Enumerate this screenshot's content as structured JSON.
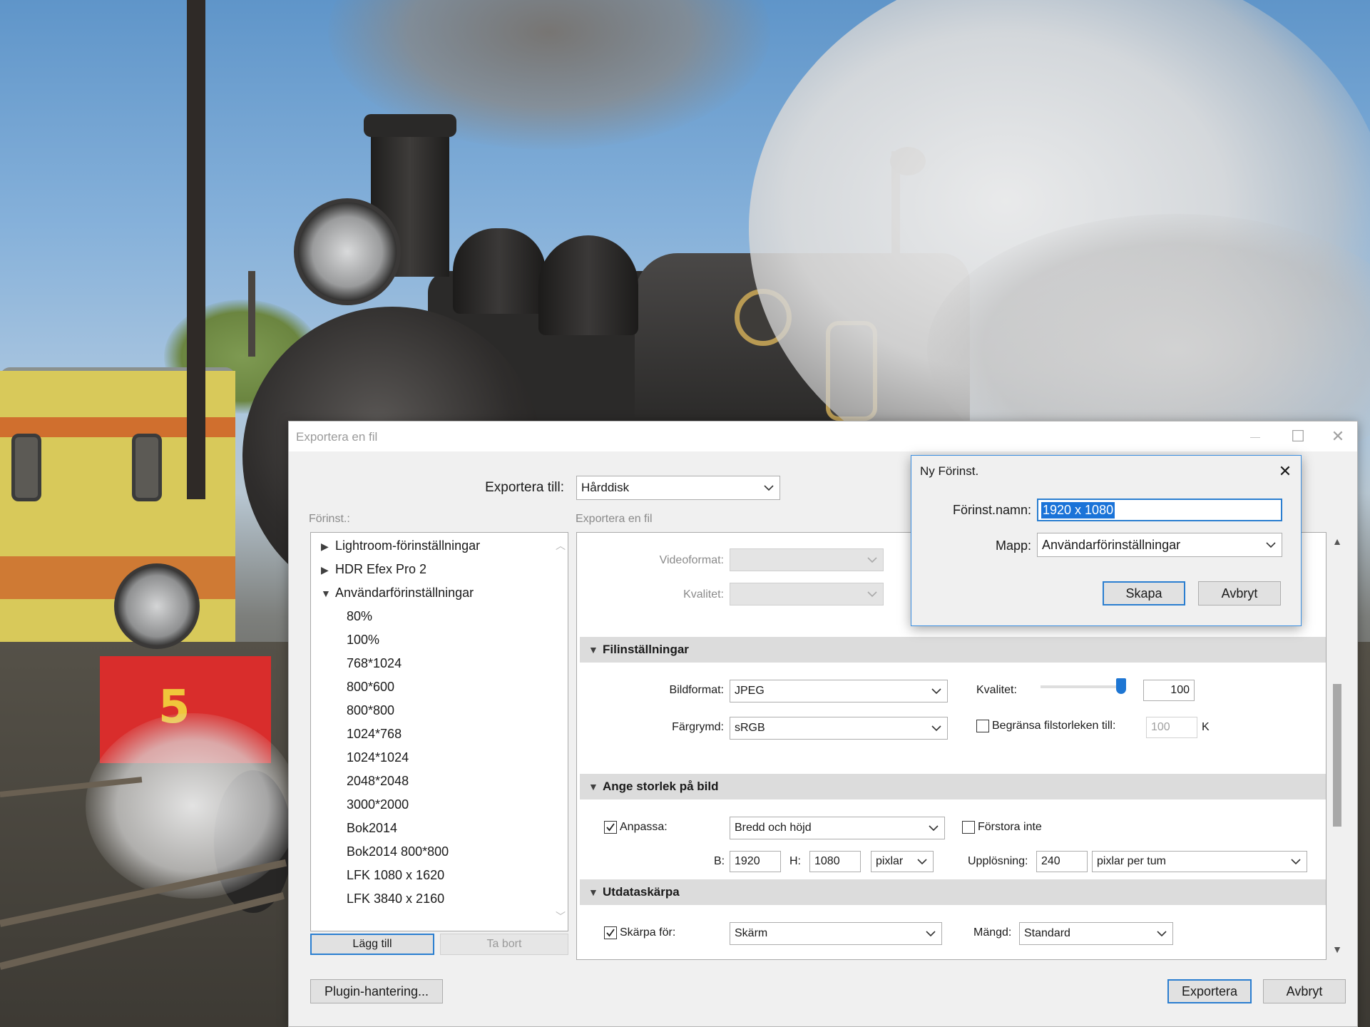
{
  "main_dialog": {
    "title": "Exportera en fil",
    "window_controls": {
      "minimize": "—",
      "maximize": "☐",
      "close": "✕"
    },
    "export_to": {
      "label": "Exportera till:",
      "value": "Hårddisk"
    },
    "presets_label": "Förinst.:",
    "settings_header": "Exportera en fil",
    "presets": [
      {
        "label": "Lightroom-förinställningar",
        "expanded": false
      },
      {
        "label": "HDR Efex Pro 2",
        "expanded": false
      },
      {
        "label": "Användarförinställningar",
        "expanded": true
      }
    ],
    "user_presets": [
      "80%",
      "100%",
      "768*1024",
      "800*600",
      "800*800",
      "1024*768",
      "1024*1024",
      "2048*2048",
      "3000*2000",
      "Bok2014",
      "Bok2014 800*800",
      "LFK 1080 x 1620",
      "LFK 3840 x 2160"
    ],
    "add_button": "Lägg till",
    "remove_button": "Ta bort",
    "plugin_button": "Plugin-hantering...",
    "export_button": "Exportera",
    "cancel_button": "Avbryt",
    "video": {
      "format_label": "Videoformat:",
      "quality_label": "Kvalitet:"
    },
    "file_settings": {
      "header": "Filinställningar",
      "format_label": "Bildformat:",
      "format_value": "JPEG",
      "quality_label": "Kvalitet:",
      "quality_value": "100",
      "quality_fraction": 1.0,
      "colorspace_label": "Färgrymd:",
      "colorspace_value": "sRGB",
      "limit_label": "Begränsa filstorleken till:",
      "limit_checked": false,
      "limit_value": "100",
      "limit_unit": "K"
    },
    "image_sizing": {
      "header": "Ange storlek på bild",
      "resize_label": "Anpassa:",
      "resize_checked": true,
      "resize_value": "Bredd och höjd",
      "dont_enlarge_label": "Förstora inte",
      "dont_enlarge_checked": false,
      "w_label": "B:",
      "w_value": "1920",
      "h_label": "H:",
      "h_value": "1080",
      "unit_value": "pixlar",
      "resolution_label": "Upplösning:",
      "resolution_value": "240",
      "resolution_unit": "pixlar per tum"
    },
    "sharpening": {
      "header": "Utdataskärpa",
      "sharpen_label": "Skärpa för:",
      "sharpen_checked": true,
      "sharpen_value": "Skärm",
      "amount_label": "Mängd:",
      "amount_value": "Standard"
    }
  },
  "new_preset_dialog": {
    "title": "Ny Förinst.",
    "name_label": "Förinst.namn:",
    "name_value": "1920 x 1080",
    "folder_label": "Mapp:",
    "folder_value": "Användarförinställningar",
    "create_button": "Skapa",
    "cancel_button": "Avbryt",
    "close": "✕"
  },
  "colors": {
    "accent": "#2a7ed0",
    "selection": "#1a73d8",
    "section_header": "#dcdcdc",
    "slider_knob": "#1e76d3"
  }
}
